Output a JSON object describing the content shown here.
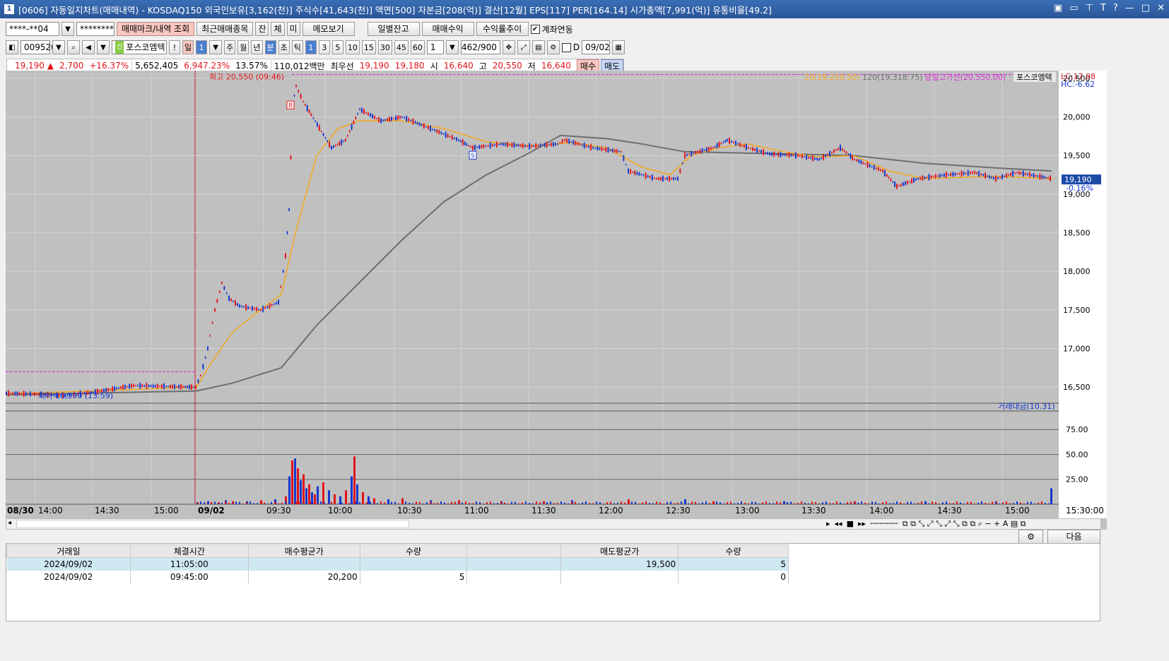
{
  "window": {
    "title": "[0606] 자동일지차트(매매내역) - KOSDAQ150 외국인보유[3,162(천)] 주식수[41,643(천)] 액면[500] 자본금[208(억)] 결산[12월] EPS[117] PER[164.14] 시가총액[7,991(억)] 유통비율[49.2]",
    "icon_label": "1"
  },
  "toolbar1": {
    "account": "****-**04",
    "password": "********",
    "trade_mark_btn": "매매마크/내역 조회",
    "recent_btn": "최근매매종목",
    "jan": "잔",
    "che": "체",
    "mi": "미",
    "memo_btn": "메모보기",
    "daily_btn": "일별잔고",
    "profit_btn": "매매수익",
    "rate_btn": "수익률추이",
    "link_label": "계좌연동"
  },
  "toolbar2": {
    "code": "009520",
    "stock_name": "포스코엠텍",
    "excl": "!",
    "day": "일",
    "day_n": "1",
    "week": "주",
    "month": "월",
    "year": "년",
    "minute": "분",
    "second": "초",
    "tick": "틱",
    "periods": [
      "1",
      "3",
      "5",
      "10",
      "15",
      "30",
      "45",
      "60"
    ],
    "n": "1",
    "count": "462",
    "count_max": "/900",
    "d_label": "D",
    "date": "09/02"
  },
  "quote": {
    "price": "19,190",
    "arrow": "▲",
    "change": "2,700",
    "pct": "+16.37%",
    "volume": "5,652,405",
    "vol_pct": "6,947.23%",
    "turnover": "13.57%",
    "amount": "110,012백만",
    "best_label": "최우선",
    "ask": "19,190",
    "bid": "19,180",
    "open_label": "시",
    "open": "16,640",
    "high_label": "고",
    "high": "20,550",
    "low_label": "저",
    "low": "16,640",
    "buy_btn": "매수",
    "sell_btn": "매도"
  },
  "chart_data": {
    "type": "line",
    "legend": {
      "ma20": "20(19,250.50)",
      "ma120": "120(19,318.75)",
      "high_line": "당일고가선(20,550.00)",
      "name": "포스코엠텍",
      "lc": "LC:17.08",
      "hc": "HC:-6.62"
    },
    "annotations": {
      "high": "최고 20,550 (09:46)",
      "low": "최저 16,390 (13:59)",
      "buy_mark": "B",
      "sell_mark": "S"
    },
    "price_ticks": [
      "20,500",
      "20,000",
      "19,500",
      "19,000",
      "18,500",
      "18,000",
      "17,500",
      "17,000",
      "16,500"
    ],
    "price_ylim": [
      16300,
      20600
    ],
    "current": {
      "price": "19,190",
      "pct": "-0.16%"
    },
    "volume_label": "거래대금(10.31)",
    "volume_ticks": [
      "75.00",
      "50.00",
      "25.00"
    ],
    "time_ticks": [
      "08/30",
      "14:00",
      "14:30",
      "15:00",
      "09/02",
      "09:30",
      "10:00",
      "10:30",
      "11:00",
      "11:30",
      "12:00",
      "12:30",
      "13:00",
      "13:30",
      "14:00",
      "14:30",
      "15:00",
      "15:30:00"
    ],
    "price_path": [
      [
        0,
        16420
      ],
      [
        40,
        16410
      ],
      [
        80,
        16390
      ],
      [
        120,
        16430
      ],
      [
        180,
        16520
      ],
      [
        220,
        16510
      ],
      [
        268,
        16500
      ],
      [
        275,
        16650
      ],
      [
        285,
        17000
      ],
      [
        295,
        17500
      ],
      [
        305,
        17850
      ],
      [
        315,
        17650
      ],
      [
        330,
        17550
      ],
      [
        360,
        17500
      ],
      [
        385,
        17600
      ],
      [
        395,
        18200
      ],
      [
        400,
        18800
      ],
      [
        405,
        20150
      ],
      [
        410,
        20400
      ],
      [
        420,
        20200
      ],
      [
        440,
        19900
      ],
      [
        460,
        19600
      ],
      [
        480,
        19700
      ],
      [
        500,
        20100
      ],
      [
        530,
        19950
      ],
      [
        560,
        20000
      ],
      [
        600,
        19850
      ],
      [
        640,
        19700
      ],
      [
        660,
        19600
      ],
      [
        700,
        19650
      ],
      [
        740,
        19620
      ],
      [
        780,
        19650
      ],
      [
        790,
        19700
      ],
      [
        830,
        19600
      ],
      [
        870,
        19550
      ],
      [
        880,
        19300
      ],
      [
        920,
        19200
      ],
      [
        950,
        19200
      ],
      [
        960,
        19500
      ],
      [
        1000,
        19600
      ],
      [
        1020,
        19700
      ],
      [
        1050,
        19600
      ],
      [
        1080,
        19520
      ],
      [
        1120,
        19500
      ],
      [
        1150,
        19450
      ],
      [
        1180,
        19600
      ],
      [
        1200,
        19450
      ],
      [
        1240,
        19300
      ],
      [
        1260,
        19100
      ],
      [
        1290,
        19200
      ],
      [
        1330,
        19250
      ],
      [
        1370,
        19280
      ],
      [
        1400,
        19200
      ],
      [
        1430,
        19280
      ],
      [
        1480,
        19200
      ]
    ],
    "ma20_path": [
      [
        0,
        16410
      ],
      [
        270,
        16500
      ],
      [
        290,
        16800
      ],
      [
        320,
        17200
      ],
      [
        360,
        17500
      ],
      [
        390,
        17700
      ],
      [
        410,
        18500
      ],
      [
        440,
        19500
      ],
      [
        470,
        19850
      ],
      [
        500,
        19950
      ],
      [
        560,
        19950
      ],
      [
        620,
        19850
      ],
      [
        680,
        19680
      ],
      [
        750,
        19620
      ],
      [
        800,
        19670
      ],
      [
        850,
        19600
      ],
      [
        900,
        19350
      ],
      [
        940,
        19250
      ],
      [
        970,
        19500
      ],
      [
        1010,
        19600
      ],
      [
        1050,
        19650
      ],
      [
        1100,
        19550
      ],
      [
        1150,
        19480
      ],
      [
        1200,
        19500
      ],
      [
        1250,
        19300
      ],
      [
        1300,
        19200
      ],
      [
        1400,
        19230
      ],
      [
        1480,
        19200
      ]
    ],
    "ma120_path": [
      [
        0,
        16400
      ],
      [
        270,
        16450
      ],
      [
        320,
        16550
      ],
      [
        390,
        16750
      ],
      [
        440,
        17300
      ],
      [
        500,
        17850
      ],
      [
        560,
        18400
      ],
      [
        620,
        18900
      ],
      [
        680,
        19250
      ],
      [
        740,
        19530
      ],
      [
        785,
        19760
      ],
      [
        850,
        19720
      ],
      [
        900,
        19650
      ],
      [
        960,
        19550
      ],
      [
        1100,
        19520
      ],
      [
        1200,
        19500
      ],
      [
        1300,
        19400
      ],
      [
        1400,
        19340
      ],
      [
        1480,
        19300
      ]
    ],
    "volume_bars": [
      [
        270,
        2
      ],
      [
        285,
        3
      ],
      [
        300,
        2
      ],
      [
        310,
        4
      ],
      [
        320,
        3
      ],
      [
        340,
        3
      ],
      [
        360,
        4
      ],
      [
        380,
        5
      ],
      [
        395,
        8
      ],
      [
        400,
        28
      ],
      [
        404,
        44
      ],
      [
        408,
        46
      ],
      [
        412,
        36
      ],
      [
        416,
        24
      ],
      [
        420,
        30
      ],
      [
        424,
        16
      ],
      [
        428,
        20
      ],
      [
        432,
        12
      ],
      [
        436,
        10
      ],
      [
        440,
        18
      ],
      [
        448,
        22
      ],
      [
        456,
        14
      ],
      [
        464,
        10
      ],
      [
        472,
        8
      ],
      [
        480,
        14
      ],
      [
        488,
        28
      ],
      [
        492,
        48
      ],
      [
        496,
        20
      ],
      [
        504,
        12
      ],
      [
        512,
        8
      ],
      [
        520,
        6
      ],
      [
        540,
        5
      ],
      [
        560,
        6
      ],
      [
        600,
        4
      ],
      [
        640,
        4
      ],
      [
        700,
        3
      ],
      [
        760,
        3
      ],
      [
        800,
        4
      ],
      [
        880,
        5
      ],
      [
        960,
        5
      ],
      [
        1000,
        3
      ],
      [
        1100,
        3
      ],
      [
        1200,
        3
      ],
      [
        1300,
        3
      ],
      [
        1400,
        3
      ],
      [
        1478,
        16
      ]
    ],
    "volume_ylim": [
      0,
      95
    ]
  },
  "trades": {
    "columns": [
      "거래일",
      "체결시간",
      "매수평균가",
      "수량",
      "",
      "매도평균가",
      "수량"
    ],
    "rows": [
      [
        "2024/09/02",
        "11:05:00",
        "",
        "",
        "",
        "19,500",
        "5"
      ],
      [
        "2024/09/02",
        "09:45:00",
        "20,200",
        "5",
        "",
        "",
        "0"
      ]
    ]
  },
  "next_btn": "다음"
}
